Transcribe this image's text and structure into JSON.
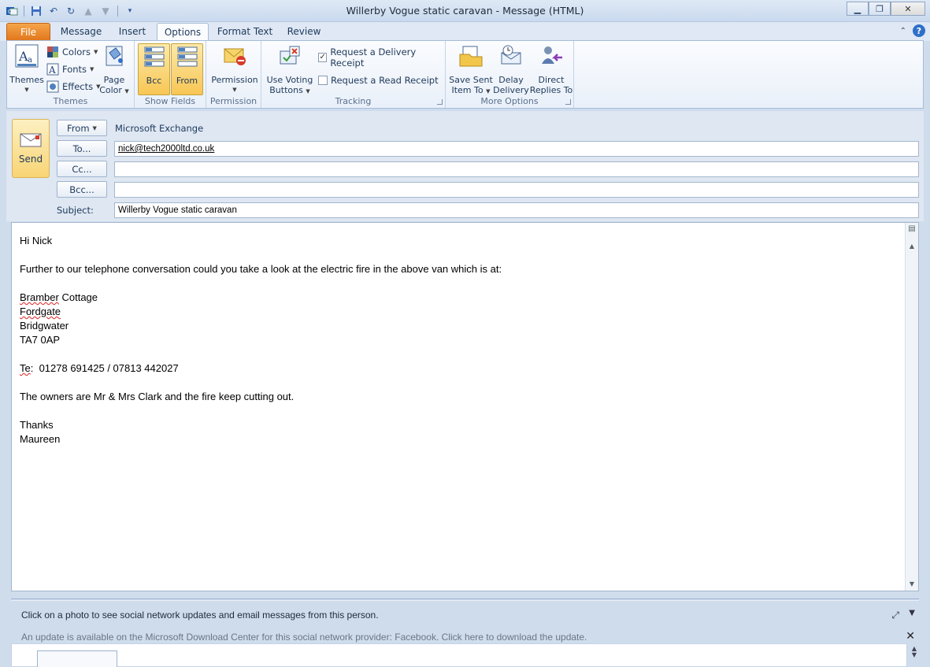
{
  "window": {
    "title": "Willerby Vogue static caravan  -  Message (HTML)"
  },
  "tabs": [
    {
      "label": "File"
    },
    {
      "label": "Message"
    },
    {
      "label": "Insert"
    },
    {
      "label": "Options"
    },
    {
      "label": "Format Text"
    },
    {
      "label": "Review"
    }
  ],
  "ribbon": {
    "themes": {
      "themes_label": "Themes",
      "colors_label": "Colors",
      "fonts_label": "Fonts",
      "effects_label": "Effects",
      "page_color_l1": "Page",
      "page_color_l2": "Color",
      "group_label": "Themes"
    },
    "show_fields": {
      "bcc_label": "Bcc",
      "from_label": "From",
      "group_label": "Show Fields"
    },
    "permission": {
      "permission_label": "Permission",
      "group_label": "Permission"
    },
    "tracking": {
      "voting_l1": "Use Voting",
      "voting_l2": "Buttons",
      "delivery_receipt": "Request a Delivery Receipt",
      "delivery_checked": true,
      "read_receipt": "Request a Read Receipt",
      "read_checked": false,
      "group_label": "Tracking"
    },
    "more_options": {
      "save_sent_l1": "Save Sent",
      "save_sent_l2": "Item To",
      "delay_l1": "Delay",
      "delay_l2": "Delivery",
      "direct_l1": "Direct",
      "direct_l2": "Replies To",
      "group_label": "More Options"
    }
  },
  "header": {
    "send_label": "Send",
    "from_button": "From",
    "from_value": "Microsoft Exchange",
    "to_button": "To...",
    "to_value": "nick@tech2000ltd.co.uk",
    "cc_button": "Cc...",
    "cc_value": "",
    "bcc_button": "Bcc...",
    "bcc_value": "",
    "subject_label": "Subject:",
    "subject_value": "Willerby Vogue static caravan"
  },
  "body": {
    "greeting": "Hi Nick",
    "line1": "Further to our telephone conversation could you take a look at the electric fire in the above van which is at:",
    "addr1_word": "Bramber",
    "addr1_rest": " Cottage",
    "addr2": "Fordgate",
    "addr3": "Bridgwater",
    "addr4": "TA7 0AP",
    "tel_word": "Te",
    "tel_rest": ":  01278 691425 / 07813 442027",
    "owners": "The owners are Mr & Mrs Clark and the fire keep cutting out.",
    "thanks": "Thanks",
    "signature": "Maureen"
  },
  "people_pane": {
    "info": "Click on a photo to see social network updates and email messages from this person.",
    "update": "An update is available on the Microsoft Download Center for this social network provider: Facebook. Click here to download the update."
  },
  "colors": {
    "file_tab": "#e2771c",
    "pressed_button": "#f7c654",
    "accent": "#2e6fc9"
  }
}
